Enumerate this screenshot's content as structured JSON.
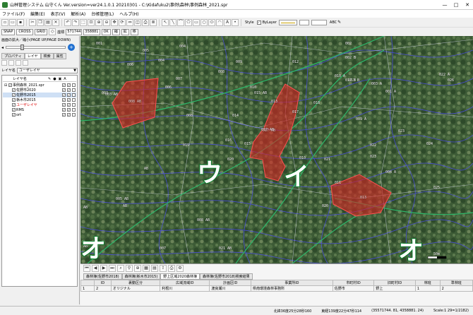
{
  "titlebar": {
    "app": "山林管理システム  山守くん Ver.version=ver24.1.0.1 20210301 - C:\\Kidafuku2\\事例\\森林\\事例森林_2021.spr",
    "min": "—",
    "max": "□",
    "close": "✕"
  },
  "menu": [
    "ファイル(F)",
    "編集(E)",
    "表示(V)",
    "解析(A)",
    "台帳管理(L)",
    "ヘルプ(H)"
  ],
  "toolbar": {
    "style_label": "Style",
    "bylayer_label": "ByLayer",
    "abc_label": "ABC"
  },
  "toolbar2": {
    "snap": "SNAP",
    "cross": "CROSS",
    "grid": "GRID",
    "coord_label": "座標",
    "x": "571744",
    "y": "358881",
    "ok": "OK",
    "b1": "縮",
    "b2": "拡",
    "b3": "移"
  },
  "leftpanel": {
    "zoom_caption": "画面の拡大／縮小(PAGE UP/PAGE DOWN)",
    "tabs": [
      "プロパティ",
      "レイヤ",
      "検索",
      "属性"
    ],
    "layer_select_label": "レイヤ名",
    "layer_select_value": "ユーザレイヤ",
    "list_header": "レイヤ名",
    "layers": [
      {
        "name": "事例森林_2021.spr",
        "indent": 0
      },
      {
        "name": "佐野市2020",
        "indent": 1
      },
      {
        "name": "佐野市2015",
        "indent": 1
      },
      {
        "name": "栃木市2015",
        "indent": 1
      },
      {
        "name": "ユーザレイヤ",
        "indent": 1,
        "red": true
      },
      {
        "name": "RMS",
        "indent": 1
      },
      {
        "name": "ort",
        "indent": 1
      }
    ]
  },
  "map": {
    "big_labels": [
      "ウ",
      "イ",
      "オ",
      "オ"
    ],
    "labels": [
      "001",
      "005",
      "004",
      "002",
      "003",
      "004",
      "006",
      "007",
      "008",
      "009",
      "010",
      "012",
      "013",
      "014",
      "015",
      "016",
      "017",
      "018",
      "019",
      "020",
      "021",
      "022",
      "023",
      "024",
      "025",
      "026",
      "003 AB",
      "009 A",
      "010 A",
      "015 AB",
      "017 AB",
      "022 A",
      "013 B",
      "011",
      "012 B",
      "004 A",
      "005 AB",
      "008 AB",
      "021 AB",
      "002 B",
      "003 A",
      "001 A",
      "010",
      "023",
      "006",
      "008",
      "007",
      "020",
      "AB",
      "AB",
      "AB",
      "AB"
    ],
    "parcel_labels": [
      "008 AB",
      "017 AB",
      "013"
    ],
    "scale_text": "50m"
  },
  "bottom": {
    "tabs": [
      "森林簿(佐野市2018)",
      "森林簿(栃木市2015)",
      "野上区域2020森林簿",
      "森林簿(佐野市2018)検索結果"
    ],
    "headers": [
      "",
      "ID",
      "裏動区分",
      "広域流域ID",
      "計画区ID",
      "事業所ID",
      "市町村ID",
      "旧町村ID",
      "林班",
      "準林班"
    ],
    "row": [
      "1",
      "2",
      "オリジナル",
      "利根川",
      "渡良瀬川",
      "県南環境森林事務所",
      "佐野市",
      "野上",
      "1",
      "2"
    ]
  },
  "status": {
    "s1": "北緯36度25分28秒160",
    "s2": "東経139度22分47秒114",
    "s3": "(35571744. 81, 4358881. 24)",
    "s4": "Scale:1 29=1/2182)"
  }
}
